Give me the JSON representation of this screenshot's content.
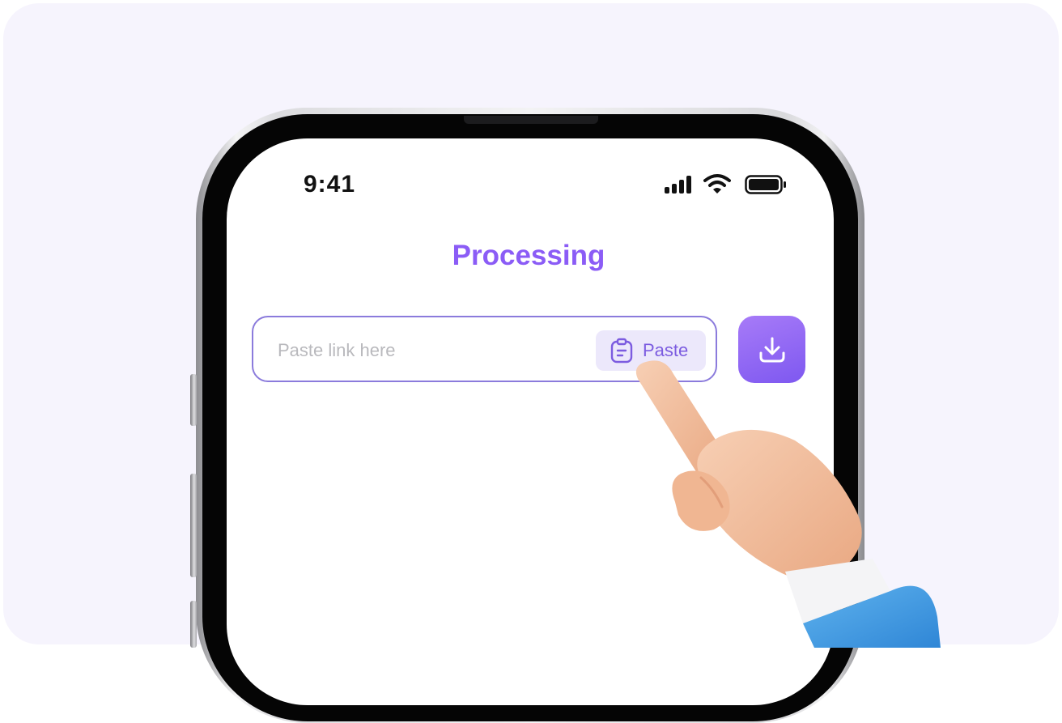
{
  "status_bar": {
    "time": "9:41"
  },
  "header": {
    "title": "Processing"
  },
  "link_input": {
    "value": "",
    "placeholder": "Paste link here"
  },
  "paste_button": {
    "label": "Paste",
    "icon": "clipboard-icon"
  },
  "download_button": {
    "icon": "download-icon"
  },
  "colors": {
    "accent": "#8b5cf6",
    "accent_dark": "#7e58f0",
    "field_border": "#8b7bdc",
    "paste_bg": "#ece8fb",
    "background": "#f6f4fd"
  },
  "illustration": {
    "icon": "hand-pointer-icon"
  }
}
